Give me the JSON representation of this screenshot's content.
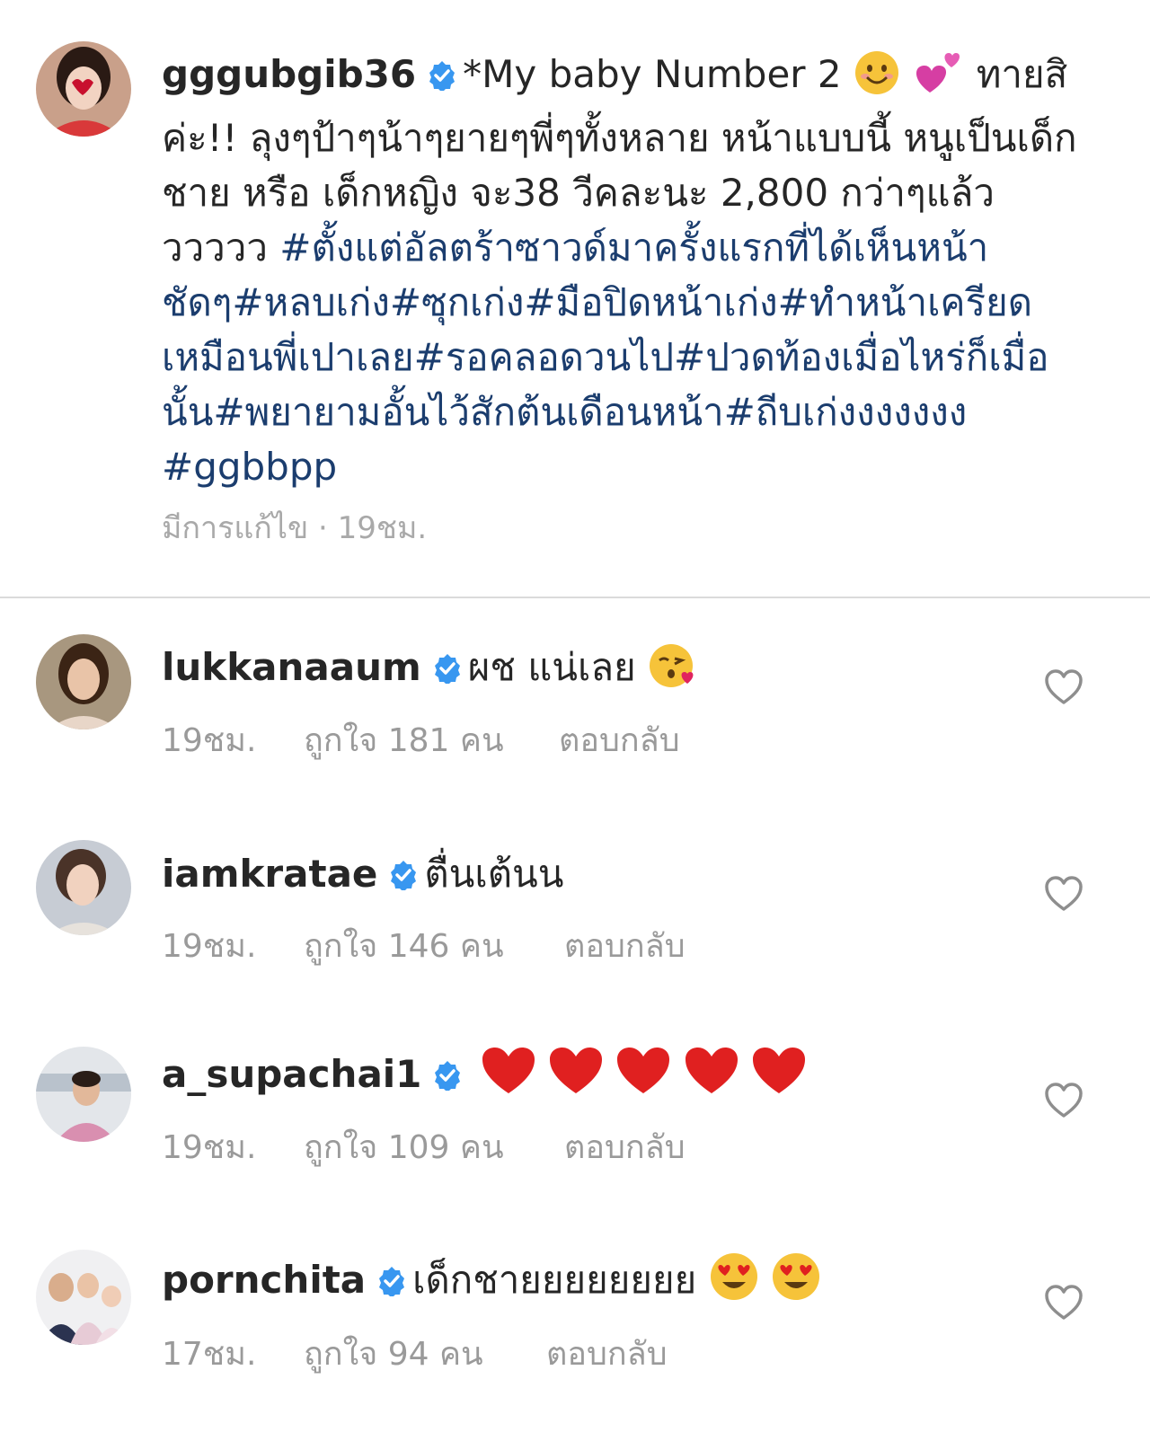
{
  "post": {
    "username": "gggubgib36",
    "caption_start": "*My baby Number 2",
    "caption_mid": "ทายสิค่ะ!! ลุงๆป้าๆน้าๆยายๆพี่ๆทั้งหลาย หน้าแบบนี้ หนูเป็นเด็ก ชาย หรือ เด็กหญิง จะ38 วีคละนะ 2,800 กว่าๆแล้วววววว",
    "hashtags": "#ตั้งแต่อัลตร้าซาวด์มาครั้งแรกที่ได้เห็นหน้าชัดๆ#หลบเก่ง#ซุกเก่ง#มือปิดหน้าเก่ง#ทำหน้าเครียดเหมือนพี่เปาเลย#รอคลอดวนไป#ปวดท้องเมื่อไหร่ก็เมื่อนั้น#พยายามอั้นไว้สักต้นเดือนหน้า#ถีบเก่งงงงงงง #ggbbpp",
    "edited_label": "มีการแก้ไข · 19ชม."
  },
  "comments": [
    {
      "username": "lukkanaaum",
      "text": "ผช แน่เลย",
      "time": "19ชม.",
      "likes": "ถูกใจ 181 คน",
      "reply": "ตอบกลับ"
    },
    {
      "username": "iamkratae",
      "text": "ตื่นเต้นน",
      "time": "19ชม.",
      "likes": "ถูกใจ 146 คน",
      "reply": "ตอบกลับ"
    },
    {
      "username": "a_supachai1",
      "text": "",
      "time": "19ชม.",
      "likes": "ถูกใจ 109 คน",
      "reply": "ตอบกลับ"
    },
    {
      "username": "pornchita",
      "text": "เด็กชายยยยยยยย",
      "time": "17ชม.",
      "likes": "ถูกใจ 94 คน",
      "reply": "ตอบกลับ"
    }
  ],
  "colors": {
    "hashtag": "#1b3d6e",
    "verified": "#3897f0",
    "meta": "#9a9a9a",
    "divider": "#dbdbdb"
  },
  "icons": [
    "verified-badge-icon",
    "heart-outline-icon",
    "smiling-emoji",
    "two-hearts-emoji",
    "kissing-heart-emoji",
    "red-heart-emoji",
    "heart-eyes-emoji"
  ]
}
